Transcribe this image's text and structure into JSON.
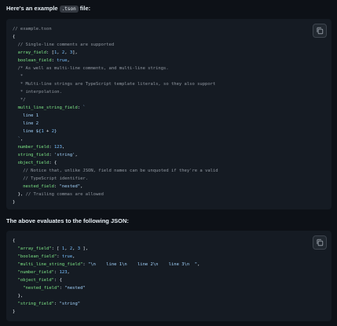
{
  "intro": {
    "text_before": "Here's an example ",
    "code": ".tson",
    "text_after": " file:"
  },
  "tson_lines": [
    [
      [
        "c",
        "// example.tson"
      ]
    ],
    [
      [
        "b",
        "{"
      ]
    ],
    [
      [
        "c",
        "  // Single-line comments are supported"
      ]
    ],
    [
      [
        "k",
        "  array_field"
      ],
      [
        "b",
        ": ["
      ],
      [
        "p",
        "1"
      ],
      [
        "b",
        ", "
      ],
      [
        "p",
        "2"
      ],
      [
        "b",
        ", "
      ],
      [
        "p",
        "3"
      ],
      [
        "b",
        "],"
      ]
    ],
    [
      [
        "k",
        "  boolean_field"
      ],
      [
        "b",
        ": "
      ],
      [
        "p",
        "true"
      ],
      [
        "b",
        ","
      ]
    ],
    [
      [
        "c",
        "  /* As well as multi-line comments, and multi-line strings."
      ]
    ],
    [
      [
        "c",
        "   *"
      ]
    ],
    [
      [
        "c",
        "   * Multi-line strings are TypeScript template literals, so they also support"
      ]
    ],
    [
      [
        "c",
        "   * interpolation."
      ]
    ],
    [
      [
        "c",
        "   */"
      ]
    ],
    [
      [
        "k",
        "  multi_line_string_field"
      ],
      [
        "b",
        ": "
      ],
      [
        "s",
        "`"
      ]
    ],
    [
      [
        "s",
        "    line 1"
      ]
    ],
    [
      [
        "s",
        "    line 2"
      ]
    ],
    [
      [
        "s",
        "    line ${"
      ],
      [
        "p",
        "1"
      ],
      [
        "b",
        " + "
      ],
      [
        "p",
        "2"
      ],
      [
        "s",
        "}"
      ]
    ],
    [
      [
        "s",
        "  `"
      ],
      [
        "b",
        ","
      ]
    ],
    [
      [
        "k",
        "  number_field"
      ],
      [
        "b",
        ": "
      ],
      [
        "p",
        "123"
      ],
      [
        "b",
        ","
      ]
    ],
    [
      [
        "k",
        "  string_field"
      ],
      [
        "b",
        ": "
      ],
      [
        "s",
        "'string'"
      ],
      [
        "b",
        ","
      ]
    ],
    [
      [
        "k",
        "  object_field"
      ],
      [
        "b",
        ": {"
      ]
    ],
    [
      [
        "c",
        "    // Notice that, unlike JSON, field names can be unquoted if they're a valid"
      ]
    ],
    [
      [
        "c",
        "    // TypeScript identifier."
      ]
    ],
    [
      [
        "k",
        "    nested_field"
      ],
      [
        "b",
        ": "
      ],
      [
        "s",
        "\"nested\""
      ],
      [
        "b",
        ","
      ]
    ],
    [
      [
        "b",
        "  }, "
      ],
      [
        "c",
        "// Trailing commas are allowed"
      ]
    ],
    [
      [
        "b",
        "}"
      ]
    ]
  ],
  "json_intro": "The above evaluates to the following JSON:",
  "json_lines": [
    [
      [
        "b",
        "{"
      ]
    ],
    [
      [
        "k",
        "  \"array_field\""
      ],
      [
        "b",
        ": [ "
      ],
      [
        "p",
        "1"
      ],
      [
        "b",
        ", "
      ],
      [
        "p",
        "2"
      ],
      [
        "b",
        ", "
      ],
      [
        "p",
        "3"
      ],
      [
        "b",
        " ],"
      ]
    ],
    [
      [
        "k",
        "  \"boolean_field\""
      ],
      [
        "b",
        ": "
      ],
      [
        "p",
        "true"
      ],
      [
        "b",
        ","
      ]
    ],
    [
      [
        "k",
        "  \"multi_line_string_field\""
      ],
      [
        "b",
        ": "
      ],
      [
        "s",
        "\"\\n    line 1\\n    line 2\\n    line 3\\n  \""
      ],
      [
        "b",
        ","
      ]
    ],
    [
      [
        "k",
        "  \"number_field\""
      ],
      [
        "b",
        ": "
      ],
      [
        "p",
        "123"
      ],
      [
        "b",
        ","
      ]
    ],
    [
      [
        "k",
        "  \"object_field\""
      ],
      [
        "b",
        ": {"
      ]
    ],
    [
      [
        "k",
        "    \"nested_field\""
      ],
      [
        "b",
        ": "
      ],
      [
        "s",
        "\"nested\""
      ]
    ],
    [
      [
        "b",
        "  },"
      ]
    ],
    [
      [
        "k",
        "  \"string_field\""
      ],
      [
        "b",
        ": "
      ],
      [
        "s",
        "\"string\""
      ]
    ],
    [
      [
        "b",
        "}"
      ]
    ]
  ],
  "icons": {
    "copy": "copy-icon"
  }
}
